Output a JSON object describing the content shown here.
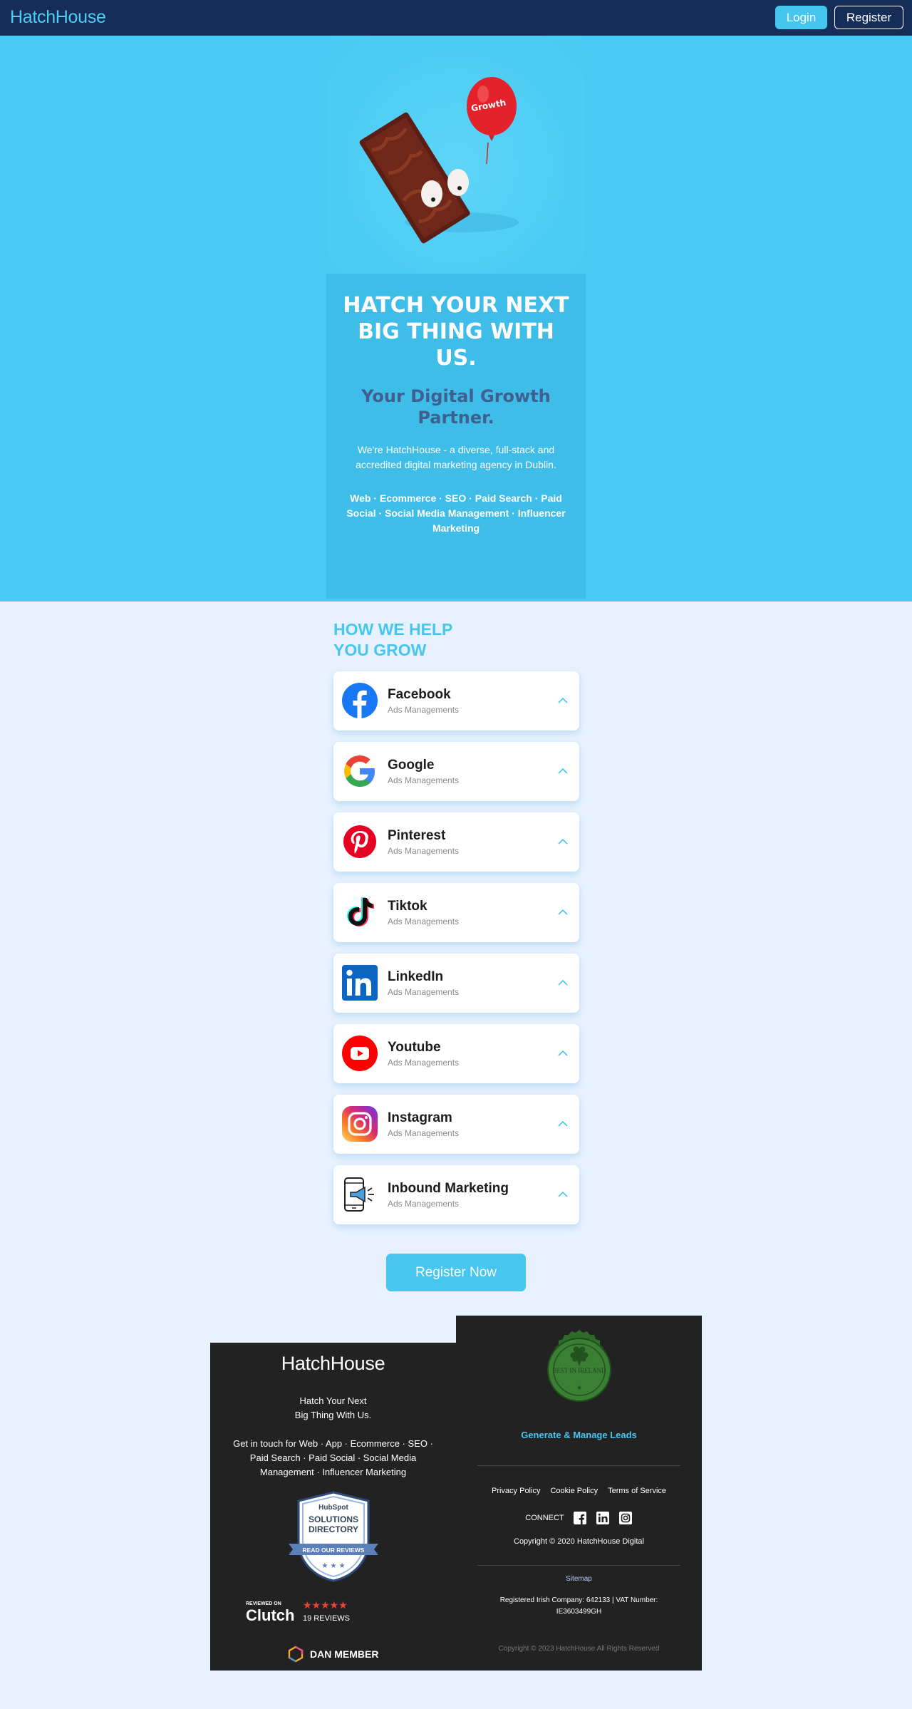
{
  "header": {
    "logo": "HatchHouse",
    "login_label": "Login",
    "register_label": "Register"
  },
  "hero": {
    "balloon_text": "Growth",
    "title": "HATCH YOUR NEXT BIG THING WITH US.",
    "subtitle": "Your Digital Growth Partner.",
    "description": "We're HatchHouse - a diverse, full-stack and accredited digital marketing agency in Dublin.",
    "services": "Web · Ecommerce · SEO · Paid Search · Paid Social · Social Media Management · Influencer Marketing"
  },
  "help": {
    "title": "HOW WE HELP YOU GROW",
    "items": [
      {
        "name": "Facebook",
        "sub": "Ads Managements",
        "icon": "facebook-icon"
      },
      {
        "name": "Google",
        "sub": "Ads Managements",
        "icon": "google-icon"
      },
      {
        "name": "Pinterest",
        "sub": "Ads Managements",
        "icon": "pinterest-icon"
      },
      {
        "name": "Tiktok",
        "sub": "Ads Managements",
        "icon": "tiktok-icon"
      },
      {
        "name": "LinkedIn",
        "sub": "Ads Managements",
        "icon": "linkedin-icon"
      },
      {
        "name": "Youtube",
        "sub": "Ads Managements",
        "icon": "youtube-icon"
      },
      {
        "name": "Instagram",
        "sub": "Ads Managements",
        "icon": "instagram-icon"
      },
      {
        "name": "Inbound Marketing",
        "sub": "Ads Managements",
        "icon": "megaphone-phone-icon"
      }
    ],
    "register_now_label": "Register Now"
  },
  "footer": {
    "logo": "HatchHouse",
    "tagline_1": "Hatch Your Next",
    "tagline_2": "Big Thing With Us.",
    "get_in_touch": "Get in touch for Web · App · Ecommerce · SEO · Paid Search · Paid Social · Social Media Management · Influencer Marketing",
    "hubspot": {
      "brand": "HubSpot",
      "line1": "SOLUTIONS",
      "line2": "DIRECTORY",
      "ribbon": "READ OUR REVIEWS"
    },
    "clutch": {
      "reviewed_on": "REVIEWED ON",
      "brand": "Clutch",
      "reviews": "19 REVIEWS"
    },
    "dan_member": "DAN MEMBER",
    "seal_text": "BEST IN IRELAND",
    "leads": "Generate & Manage Leads",
    "links": [
      "Privacy Policy",
      "Cookie Policy",
      "Terms of Service"
    ],
    "connect": "CONNECT",
    "copyright": "Copyright © 2020 HatchHouse Digital",
    "sitemap": "Sitemap",
    "registered": "Registered Irish Company: 642133 | VAT Number: IE3603499GH",
    "rights": "Copyright © 2023 HatchHouse All Rights Reserved"
  },
  "colors": {
    "header_bg": "#172d59",
    "hero_bg": "#47cbf4",
    "accent": "#47c6ef",
    "page_bg": "#e8f2fe",
    "footer_bg": "#222222"
  }
}
